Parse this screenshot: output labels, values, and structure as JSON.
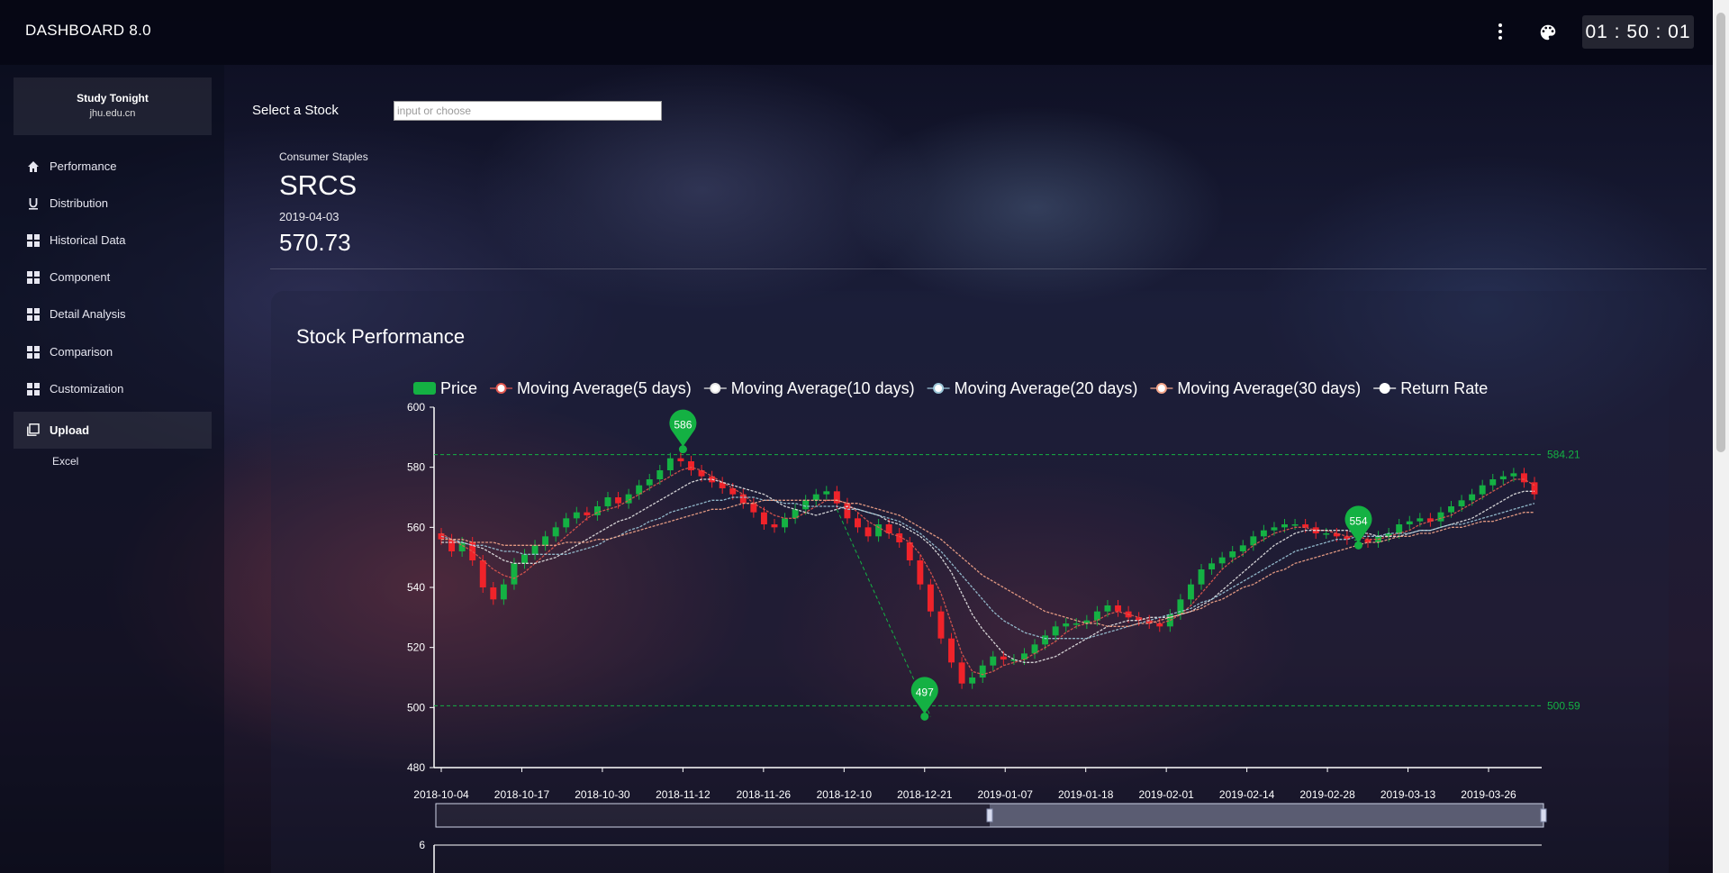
{
  "app": {
    "title": "DASHBOARD 8.0",
    "clock": "01 : 50 : 01"
  },
  "header_icons": [
    "more-vert-icon",
    "palette-icon"
  ],
  "user": {
    "name": "Study Tonight",
    "domain": "jhu.edu.cn"
  },
  "sidebar": {
    "items": [
      {
        "label": "Performance",
        "icon": "home-icon"
      },
      {
        "label": "Distribution",
        "icon": "underline-icon"
      },
      {
        "label": "Historical Data",
        "icon": "grid-icon"
      },
      {
        "label": "Component",
        "icon": "grid-icon"
      },
      {
        "label": "Detail Analysis",
        "icon": "grid-icon"
      },
      {
        "label": "Comparison",
        "icon": "grid-icon"
      },
      {
        "label": "Customization",
        "icon": "grid-icon"
      },
      {
        "label": "Upload",
        "icon": "copy-icon",
        "active": true
      }
    ],
    "subitems": [
      {
        "label": "Excel"
      }
    ]
  },
  "stock_select": {
    "label": "Select a Stock",
    "placeholder": "input or choose",
    "value": ""
  },
  "quote": {
    "sector": "Consumer Staples",
    "ticker": "SRCS",
    "date": "2019-04-03",
    "price": "570.73"
  },
  "card": {
    "title": "Stock Performance"
  },
  "colors": {
    "up": "#14b143",
    "down": "#ef232a",
    "ma5": "#e0564f",
    "ma10": "#e6e6e6",
    "ma20": "#9cc7d8",
    "ma30": "#f4a58a",
    "markline": "#14b143"
  },
  "chart_data": {
    "type": "candlestick",
    "legend": [
      {
        "name": "Price",
        "symbol": "rect",
        "color": "#14b143"
      },
      {
        "name": "Moving Average(5 days)",
        "symbol": "circle",
        "color": "#e0564f"
      },
      {
        "name": "Moving Average(10 days)",
        "symbol": "circle",
        "color": "#e6e6e6"
      },
      {
        "name": "Moving Average(20 days)",
        "symbol": "circle",
        "color": "#9cc7d8"
      },
      {
        "name": "Moving Average(30 days)",
        "symbol": "circle",
        "color": "#f4a58a"
      },
      {
        "name": "Return Rate",
        "symbol": "circle",
        "color": "#ffffff"
      }
    ],
    "legend_position": "top-center",
    "ylim": [
      480,
      600
    ],
    "yticks": [
      480,
      500,
      520,
      540,
      560,
      580,
      600
    ],
    "xticks": [
      "2018-10-04",
      "2018-10-17",
      "2018-10-30",
      "2018-11-12",
      "2018-11-26",
      "2018-12-10",
      "2018-12-21",
      "2019-01-07",
      "2019-01-18",
      "2019-02-01",
      "2019-02-14",
      "2019-02-28",
      "2019-03-13",
      "2019-03-26"
    ],
    "close_series": [
      556,
      552,
      555,
      549,
      540,
      536,
      541,
      548,
      551,
      554,
      557,
      560,
      563,
      565,
      564,
      567,
      570,
      568,
      571,
      574,
      576,
      579,
      583,
      582,
      579,
      577,
      575,
      573,
      571,
      568,
      565,
      561,
      560,
      563,
      566,
      569,
      571,
      572,
      568,
      563,
      560,
      557,
      561,
      558,
      555,
      549,
      541,
      532,
      523,
      515,
      508,
      510,
      514,
      517,
      516,
      516,
      518,
      521,
      524,
      527,
      528,
      528,
      529,
      532,
      534,
      532,
      530,
      529,
      528,
      527,
      531,
      536,
      541,
      546,
      548,
      550,
      552,
      554,
      557,
      559,
      560,
      561,
      561,
      560,
      558,
      558,
      557,
      556,
      556,
      555,
      557,
      558,
      561,
      562,
      563,
      562,
      565,
      567,
      569,
      571,
      574,
      576,
      577,
      578,
      575,
      571
    ],
    "ma5": [
      558,
      556,
      554,
      552,
      549,
      546,
      544,
      543,
      545,
      548,
      551,
      554,
      557,
      560,
      563,
      565,
      566,
      567,
      569,
      571,
      573,
      575,
      577,
      579,
      580,
      579,
      577,
      575,
      573,
      571,
      568,
      566,
      564,
      563,
      563,
      565,
      567,
      569,
      569,
      568,
      565,
      562,
      560,
      558,
      557,
      555,
      551,
      545,
      538,
      528,
      518,
      512,
      511,
      512,
      514,
      515,
      516,
      518,
      520,
      522,
      525,
      527,
      528,
      529,
      531,
      532,
      531,
      530,
      529,
      528,
      529,
      531,
      534,
      538,
      542,
      546,
      549,
      551,
      554,
      556,
      558,
      559,
      560,
      560,
      559,
      559,
      558,
      557,
      557,
      556,
      556,
      557,
      558,
      559,
      561,
      562,
      563,
      564,
      566,
      568,
      570,
      572,
      574,
      576,
      576,
      574
    ],
    "ma10": [
      555,
      555,
      555,
      554,
      553,
      551,
      549,
      548,
      548,
      548,
      549,
      550,
      552,
      554,
      556,
      558,
      560,
      562,
      563,
      565,
      567,
      569,
      571,
      573,
      575,
      576,
      576,
      575,
      574,
      573,
      572,
      571,
      569,
      567,
      566,
      565,
      564,
      565,
      566,
      567,
      566,
      565,
      564,
      562,
      561,
      559,
      557,
      554,
      550,
      545,
      538,
      531,
      526,
      522,
      518,
      516,
      515,
      515,
      516,
      517,
      519,
      521,
      523,
      525,
      527,
      528,
      529,
      529,
      530,
      530,
      530,
      531,
      532,
      534,
      536,
      539,
      542,
      545,
      548,
      551,
      554,
      556,
      558,
      559,
      559,
      559,
      559,
      559,
      558,
      558,
      557,
      557,
      557,
      558,
      559,
      559,
      560,
      561,
      562,
      563,
      565,
      567,
      569,
      571,
      572,
      572
    ],
    "ma20": [
      557,
      556,
      555,
      554,
      554,
      553,
      552,
      552,
      551,
      551,
      551,
      551,
      551,
      552,
      553,
      554,
      556,
      557,
      559,
      560,
      562,
      563,
      565,
      566,
      567,
      568,
      569,
      569,
      570,
      570,
      570,
      569,
      569,
      568,
      568,
      567,
      567,
      567,
      567,
      566,
      566,
      565,
      564,
      563,
      562,
      560,
      558,
      555,
      552,
      548,
      544,
      540,
      536,
      532,
      529,
      527,
      525,
      524,
      523,
      523,
      523,
      523,
      523,
      524,
      525,
      526,
      527,
      528,
      529,
      530,
      531,
      532,
      533,
      535,
      536,
      538,
      540,
      542,
      544,
      546,
      548,
      550,
      552,
      553,
      554,
      555,
      556,
      556,
      557,
      557,
      557,
      558,
      558,
      558,
      559,
      559,
      560,
      561,
      561,
      562,
      563,
      564,
      565,
      566,
      567,
      568
    ],
    "ma30": [
      556,
      556,
      556,
      555,
      555,
      555,
      554,
      554,
      554,
      554,
      554,
      554,
      555,
      555,
      555,
      556,
      556,
      557,
      558,
      559,
      560,
      561,
      562,
      563,
      564,
      565,
      566,
      566,
      567,
      568,
      568,
      569,
      569,
      569,
      569,
      569,
      569,
      569,
      569,
      568,
      568,
      567,
      566,
      565,
      564,
      562,
      560,
      558,
      556,
      553,
      550,
      547,
      544,
      542,
      540,
      538,
      536,
      534,
      532,
      531,
      530,
      529,
      528,
      528,
      527,
      527,
      527,
      528,
      528,
      529,
      530,
      531,
      532,
      533,
      535,
      536,
      538,
      540,
      541,
      543,
      545,
      546,
      548,
      549,
      550,
      551,
      552,
      553,
      554,
      555,
      555,
      556,
      557,
      557,
      558,
      558,
      559,
      560,
      560,
      561,
      562,
      562,
      563,
      564,
      565,
      565
    ],
    "mark_points": [
      {
        "label": "586",
        "date": "2018-11-12",
        "value": 586
      },
      {
        "label": "497",
        "date": "2018-12-21",
        "value": 497
      },
      {
        "label": "554",
        "date": "2019-03-05",
        "value": 554
      }
    ],
    "mark_lines": [
      {
        "label": "584.21",
        "value": 584.21
      },
      {
        "label": "500.59",
        "value": 500.59
      }
    ],
    "lower_axis_top_tick": "6"
  }
}
